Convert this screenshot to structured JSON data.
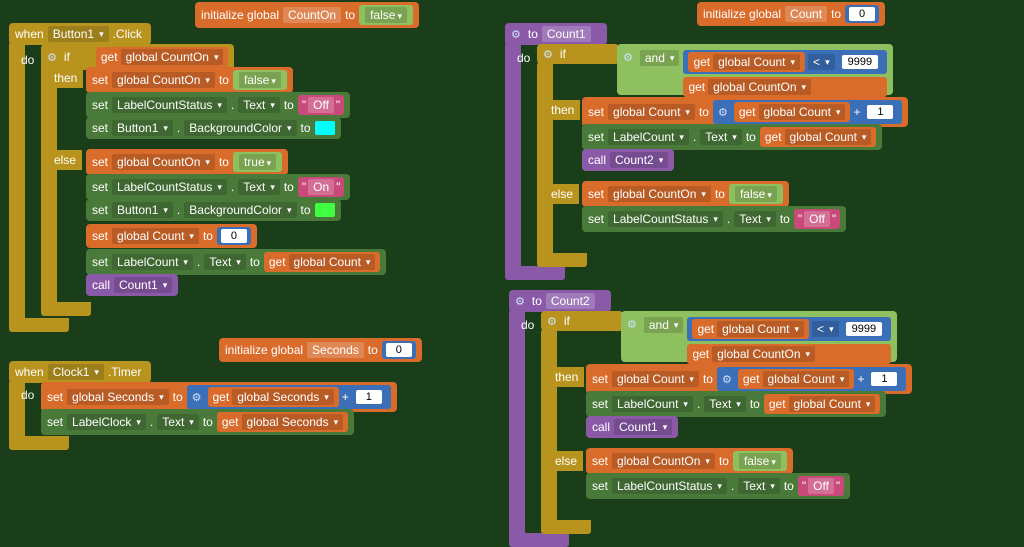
{
  "globals": {
    "counton": {
      "label": "initialize global",
      "name": "CountOn",
      "to": "to",
      "value": "false"
    },
    "count": {
      "label": "initialize global",
      "name": "Count",
      "to": "to",
      "value": "0"
    },
    "seconds": {
      "label": "initialize global",
      "name": "Seconds",
      "to": "to",
      "value": "0"
    }
  },
  "button1_click": {
    "when": "when",
    "comp": "Button1",
    "evt": ".Click",
    "do": "do",
    "if": "if",
    "then": "then",
    "else": "else",
    "get": "get",
    "gco": "global CountOn",
    "set": "set",
    "to": "to",
    "false": "false",
    "true": "true",
    "lcs": "LabelCountStatus",
    "text": "Text",
    "off": "Off",
    "on": "On",
    "btn1": "Button1",
    "bg": "BackgroundColor",
    "cyan": "#00ffff",
    "lime": "#40ff40",
    "gc": "global Count",
    "zero": "0",
    "lc": "LabelCount",
    "call": "call",
    "count1": "Count1"
  },
  "clock1_timer": {
    "when": "when",
    "comp": "Clock1",
    "evt": ".Timer",
    "do": "do",
    "set": "set",
    "gs": "global Seconds",
    "to": "to",
    "get": "get",
    "plus": "+",
    "one": "1",
    "lclock": "LabelClock",
    "text": "Text"
  },
  "count1_proc": {
    "to": "to",
    "name": "Count1",
    "do": "do",
    "if": "if",
    "then": "then",
    "else": "else",
    "and": "and",
    "get": "get",
    "gc": "global Count",
    "lt": "<",
    "max": "9999",
    "gco": "global CountOn",
    "set": "set",
    "tot": "to",
    "plus": "+",
    "one": "1",
    "lc": "LabelCount",
    "text": "Text",
    "call": "call",
    "count2": "Count2",
    "false": "false",
    "lcs": "LabelCountStatus",
    "off": "Off"
  },
  "count2_proc": {
    "to": "to",
    "name": "Count2",
    "do": "do",
    "if": "if",
    "then": "then",
    "else": "else",
    "and": "and",
    "get": "get",
    "gc": "global Count",
    "lt": "<",
    "max": "9999",
    "gco": "global CountOn",
    "set": "set",
    "tot": "to",
    "plus": "+",
    "one": "1",
    "lc": "LabelCount",
    "text": "Text",
    "call": "call",
    "count1": "Count1",
    "false": "false",
    "lcs": "LabelCountStatus",
    "off": "Off"
  }
}
